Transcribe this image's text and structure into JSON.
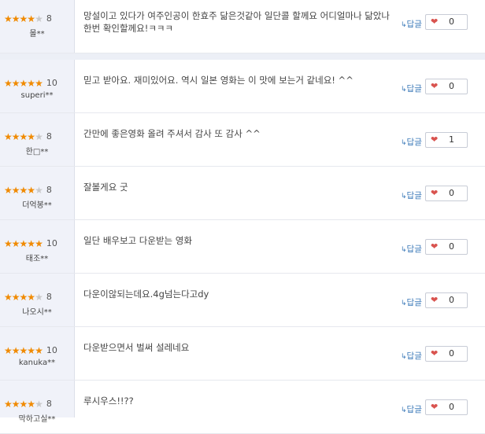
{
  "reply_label": "답글",
  "colors": {
    "star": "#f08a00",
    "star_empty": "#c9c9c9",
    "reply": "#3a78b8",
    "heart": "#d9534f"
  },
  "reviews": [
    {
      "stars": 4,
      "score": "8",
      "user": "몰**",
      "comment": "망설이고 있다가 여주인공이 한효주 닮은것같아 일단콜 할께요 어디얼마나 닮았나 한번 확인할께요!ㅋㅋㅋ",
      "likes": "0"
    },
    {
      "stars": 5,
      "score": "10",
      "user": "superi**",
      "comment": "믿고 받아요. 재미있어요. 역시 일본 영화는 이 맛에 보는거 같네요! ^^",
      "likes": "0"
    },
    {
      "stars": 4,
      "score": "8",
      "user": "한□**",
      "comment": "간만에 좋은영화 올려 주셔서 감사 또 감사 ^^",
      "likes": "1"
    },
    {
      "stars": 4,
      "score": "8",
      "user": "더억봉**",
      "comment": "잘볼게요 굿",
      "likes": "0"
    },
    {
      "stars": 5,
      "score": "10",
      "user": "태조**",
      "comment": "일단 배우보고 다운받는 영화",
      "likes": "0"
    },
    {
      "stars": 4,
      "score": "8",
      "user": "나오시**",
      "comment": "다운이않되는데요.4g넘는다고dy",
      "likes": "0"
    },
    {
      "stars": 5,
      "score": "10",
      "user": "kanuka**",
      "comment": "다운받으면서 벌써 설레네요",
      "likes": "0"
    },
    {
      "stars": 4,
      "score": "8",
      "user": "막하고실**",
      "comment": "루시우스!!??",
      "likes": "0"
    }
  ]
}
